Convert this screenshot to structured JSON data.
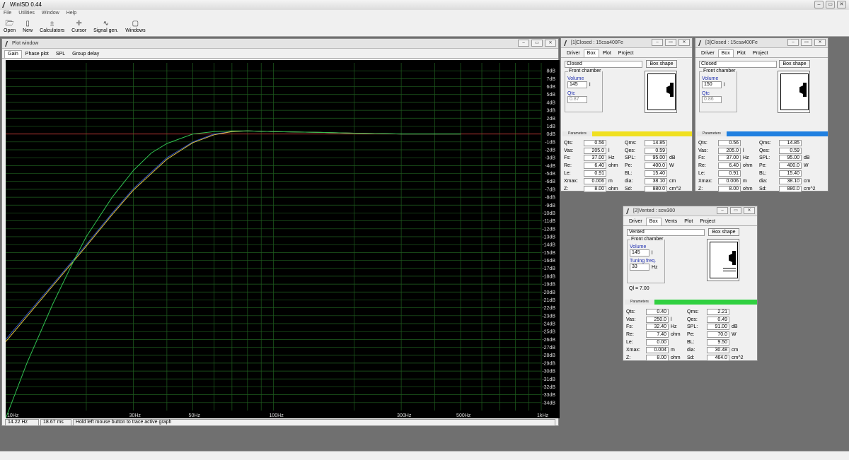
{
  "app": {
    "title": "WinISD 0.44"
  },
  "menu": [
    "File",
    "Utilities",
    "Window",
    "Help"
  ],
  "toolbar": [
    {
      "label": "Open",
      "icon": "folder-open-icon",
      "glyph": "🗁"
    },
    {
      "label": "New",
      "icon": "new-document-icon",
      "glyph": "▯"
    },
    {
      "label": "Calculators",
      "icon": "calculator-icon",
      "glyph": "±"
    },
    {
      "label": "Cursor",
      "icon": "cursor-icon",
      "glyph": "✛"
    },
    {
      "label": "Signal gen.",
      "icon": "signal-generator-icon",
      "glyph": "∿"
    },
    {
      "label": "Windows",
      "icon": "windows-icon",
      "glyph": "▢"
    }
  ],
  "window_buttons": [
    "‒",
    "▭",
    "✕"
  ],
  "plot": {
    "title": "Plot window",
    "tabs": [
      "Gain",
      "Phase plot",
      "SPL",
      "Group delay"
    ],
    "active_tab": "Gain",
    "status": {
      "freq": "14.22 Hz",
      "time": "18.67 ms",
      "hint": "Hold left mouse button to trace active graph"
    }
  },
  "chart_data": {
    "type": "line",
    "xscale": "log",
    "xlim": [
      10,
      1000
    ],
    "ylim": [
      -35,
      9
    ],
    "x_tick_labels": [
      {
        "v": 10,
        "t": "10Hz"
      },
      {
        "v": 30,
        "t": "30Hz"
      },
      {
        "v": 50,
        "t": "50Hz"
      },
      {
        "v": 100,
        "t": "100Hz"
      },
      {
        "v": 300,
        "t": "300Hz"
      },
      {
        "v": 500,
        "t": "500Hz"
      },
      {
        "v": 1000,
        "t": "1kHz"
      }
    ],
    "y_ticks": [
      8,
      7,
      6,
      5,
      4,
      3,
      2,
      1,
      0,
      -1,
      -2,
      -3,
      -4,
      -5,
      -6,
      -7,
      -8,
      -9,
      -10,
      -11,
      -12,
      -13,
      -14,
      -15,
      -16,
      -17,
      -18,
      -19,
      -20,
      -21,
      -22,
      -23,
      -24,
      -25,
      -26,
      -27,
      -28,
      -29,
      -30,
      -31,
      -32,
      -33,
      -34
    ],
    "y_unit": "dB",
    "grid": true,
    "reference_lines": [
      {
        "y": 0,
        "color": "#b03030"
      }
    ],
    "series": [
      {
        "color": "#3050c0",
        "x": [
          10,
          15,
          20,
          25,
          30,
          40,
          50,
          60,
          70,
          80,
          100,
          150,
          200,
          300,
          500
        ],
        "y": [
          -26.0,
          -19.0,
          -14.0,
          -10.0,
          -6.9,
          -3.0,
          -1.0,
          0.0,
          0.3,
          0.4,
          0.3,
          0.2,
          0.1,
          0.0,
          0.0
        ]
      },
      {
        "color": "#e0c040",
        "x": [
          10,
          15,
          20,
          25,
          30,
          40,
          50,
          60,
          70,
          80,
          100,
          150,
          200,
          300,
          500
        ],
        "y": [
          -26.3,
          -19.2,
          -14.2,
          -10.2,
          -7.1,
          -3.2,
          -1.1,
          -0.1,
          0.3,
          0.4,
          0.3,
          0.2,
          0.1,
          0.0,
          0.0
        ]
      },
      {
        "color": "#30c050",
        "x": [
          10,
          12,
          15,
          18,
          20,
          25,
          30,
          35,
          40,
          50,
          60,
          70,
          80,
          100,
          150,
          200,
          300,
          500
        ],
        "y": [
          -36,
          -29,
          -21.5,
          -16.0,
          -13.0,
          -8.0,
          -4.6,
          -2.4,
          -1.2,
          0.0,
          0.3,
          0.4,
          0.4,
          0.3,
          0.2,
          0.1,
          0.0,
          0.0
        ]
      }
    ]
  },
  "closed1": {
    "title": "[1]Closed : 15csa400Fe",
    "tabs": [
      "Driver",
      "Box",
      "Plot",
      "Project"
    ],
    "box_type": "Closed",
    "box_shape": "Box shape",
    "front_chamber": "Front chamber",
    "volume_label": "Volume",
    "volume": "145",
    "volume_unit": "l",
    "qtc_label": "Qtc",
    "qtc": "0.87",
    "params_label": "Parameters",
    "color": "#f0e020",
    "params": [
      [
        "Qts:",
        "0.56",
        "",
        "Qms:",
        "14.85",
        ""
      ],
      [
        "Vas:",
        "205.0",
        "l",
        "Qes:",
        "0.59",
        ""
      ],
      [
        "Fs:",
        "37.00",
        "Hz",
        "SPL:",
        "95.00",
        "dB"
      ],
      [
        "Re:",
        "6.40",
        "ohm",
        "Pe:",
        "400.0",
        "W"
      ],
      [
        "Le:",
        "0.91",
        "",
        "BL:",
        "15.40",
        ""
      ],
      [
        "Xmax:",
        "0.006",
        "m",
        "dia:",
        "38.10",
        "cm"
      ],
      [
        "Z:",
        "8.00",
        "ohm",
        "Sd:",
        "880.0",
        "cm^2"
      ]
    ]
  },
  "closed3": {
    "title": "[3]Closed : 15csa400Fe",
    "tabs": [
      "Driver",
      "Box",
      "Plot",
      "Project"
    ],
    "box_type": "Closed",
    "box_shape": "Box shape",
    "front_chamber": "Front chamber",
    "volume_label": "Volume",
    "volume": "150",
    "volume_unit": "l",
    "qtc_label": "Qtc",
    "qtc": "0.86",
    "params_label": "Parameters",
    "color": "#2080e0",
    "params": [
      [
        "Qts:",
        "0.56",
        "",
        "Qms:",
        "14.85",
        ""
      ],
      [
        "Vas:",
        "205.0",
        "l",
        "Qes:",
        "0.59",
        ""
      ],
      [
        "Fs:",
        "37.00",
        "Hz",
        "SPL:",
        "95.00",
        "dB"
      ],
      [
        "Re:",
        "6.40",
        "ohm",
        "Pe:",
        "400.0",
        "W"
      ],
      [
        "Le:",
        "0.91",
        "",
        "BL:",
        "15.40",
        ""
      ],
      [
        "Xmax:",
        "0.006",
        "m",
        "dia:",
        "38.10",
        "cm"
      ],
      [
        "Z:",
        "8.00",
        "ohm",
        "Sd:",
        "880.0",
        "cm^2"
      ]
    ]
  },
  "vented2": {
    "title": "[2]Vented : scw300",
    "tabs": [
      "Driver",
      "Box",
      "Vents",
      "Plot",
      "Project"
    ],
    "box_type": "Vented",
    "box_shape": "Box shape",
    "front_chamber": "Front chamber",
    "volume_label": "Volume",
    "volume": "145",
    "volume_unit": "l",
    "tuning_label": "Tuning freq.",
    "tuning": "33",
    "tuning_unit": "Hz",
    "ql": "Ql = 7.00",
    "params_label": "Parameters",
    "color": "#30d040",
    "params": [
      [
        "Qts:",
        "0.40",
        "",
        "Qms:",
        "2.21",
        ""
      ],
      [
        "Vas:",
        "250.0",
        "l",
        "Qes:",
        "0.49",
        ""
      ],
      [
        "Fs:",
        "32.40",
        "Hz",
        "SPL:",
        "91.00",
        "dB"
      ],
      [
        "Re:",
        "7.40",
        "ohm",
        "Pe:",
        "70.0",
        "W"
      ],
      [
        "Le:",
        "0.00",
        "",
        "BL:",
        "9.50",
        ""
      ],
      [
        "Xmax:",
        "0.004",
        "m",
        "dia:",
        "30.48",
        "cm"
      ],
      [
        "Z:",
        "8.00",
        "ohm",
        "Sd:",
        "464.0",
        "cm^2"
      ]
    ]
  }
}
